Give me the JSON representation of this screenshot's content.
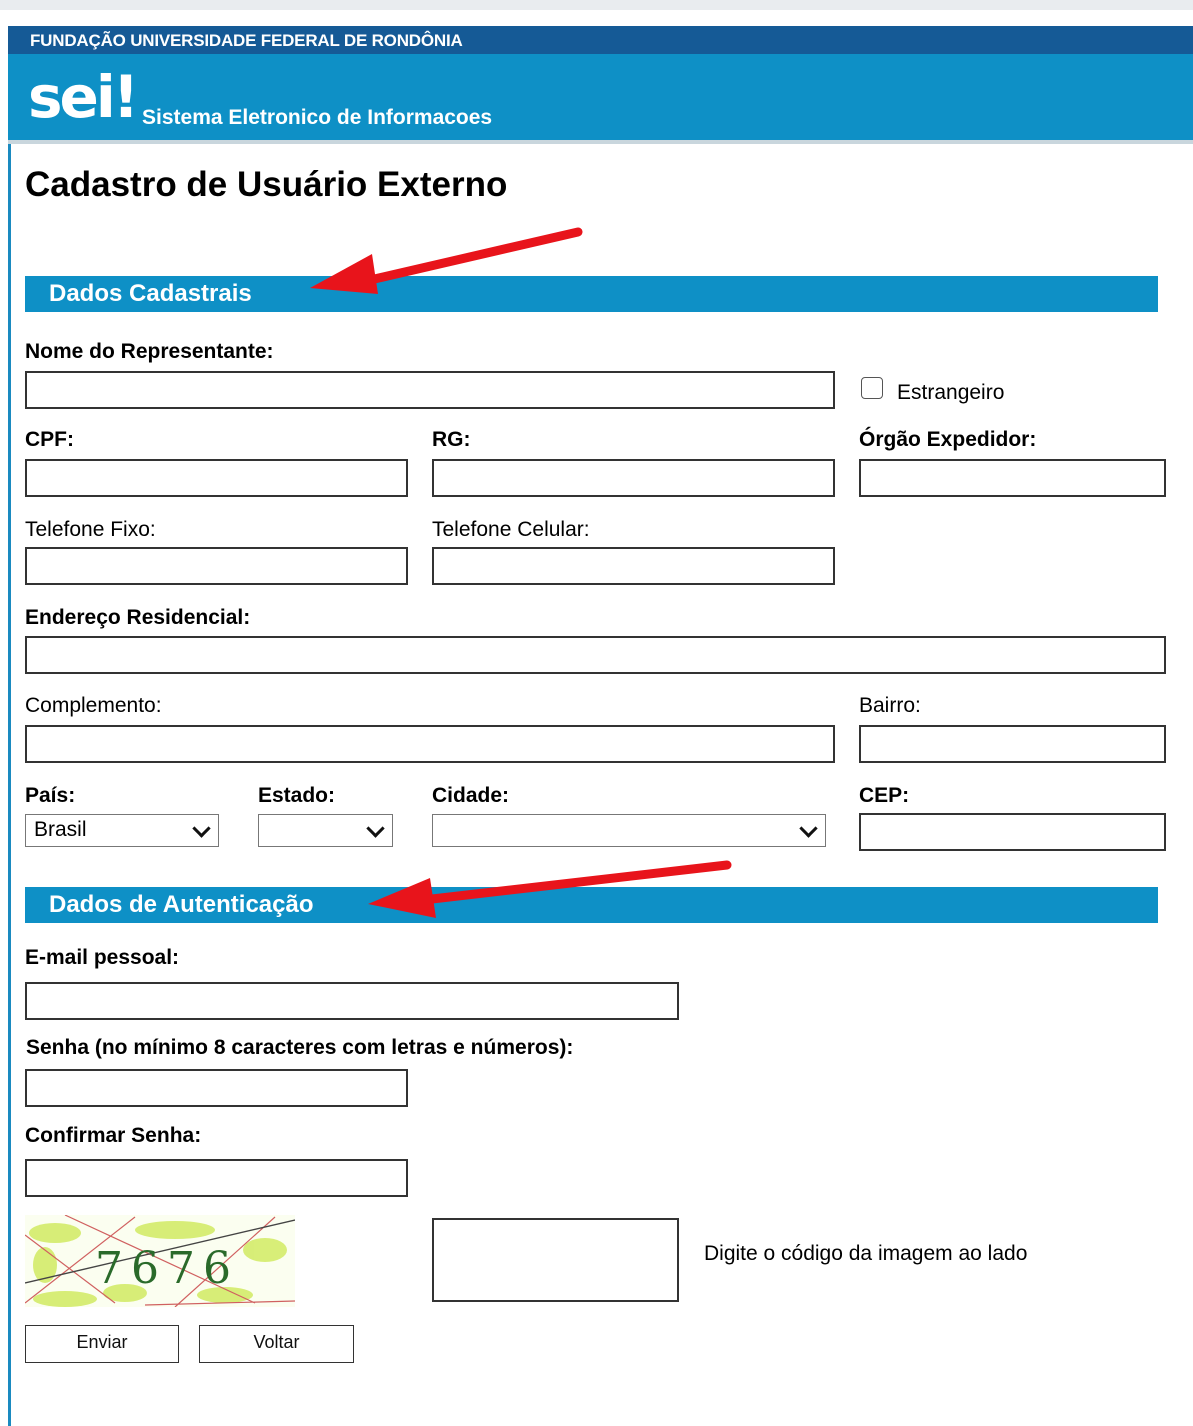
{
  "header": {
    "org_name": "FUNDAÇÃO UNIVERSIDADE FEDERAL DE RONDÔNIA",
    "logo_text": "sei!",
    "system_name": "Sistema Eletronico de Informacoes"
  },
  "page_title": "Cadastro de Usuário Externo",
  "sections": {
    "cadastrais": "Dados Cadastrais",
    "autenticacao": "Dados de Autenticação"
  },
  "fields": {
    "nome_label": "Nome do Representante:",
    "estrangeiro_label": "Estrangeiro",
    "cpf_label": "CPF:",
    "rg_label": "RG:",
    "orgao_label": "Órgão Expedidor:",
    "telefone_fixo_label": "Telefone Fixo:",
    "telefone_celular_label": "Telefone Celular:",
    "endereco_label": "Endereço Residencial:",
    "complemento_label": "Complemento:",
    "bairro_label": "Bairro:",
    "pais_label": "País:",
    "pais_value": "Brasil",
    "estado_label": "Estado:",
    "estado_value": "",
    "cidade_label": "Cidade:",
    "cidade_value": "",
    "cep_label": "CEP:",
    "email_label": "E-mail pessoal:",
    "senha_label": "Senha (no mínimo 8 caracteres com letras e números):",
    "confirmar_label": "Confirmar Senha:",
    "captcha_code": "7676",
    "captcha_hint": "Digite o código da imagem ao lado"
  },
  "buttons": {
    "enviar": "Enviar",
    "voltar": "Voltar"
  },
  "colors": {
    "header_dark": "#155a96",
    "header_blue": "#0e90c6",
    "arrow_red": "#e8141b"
  }
}
